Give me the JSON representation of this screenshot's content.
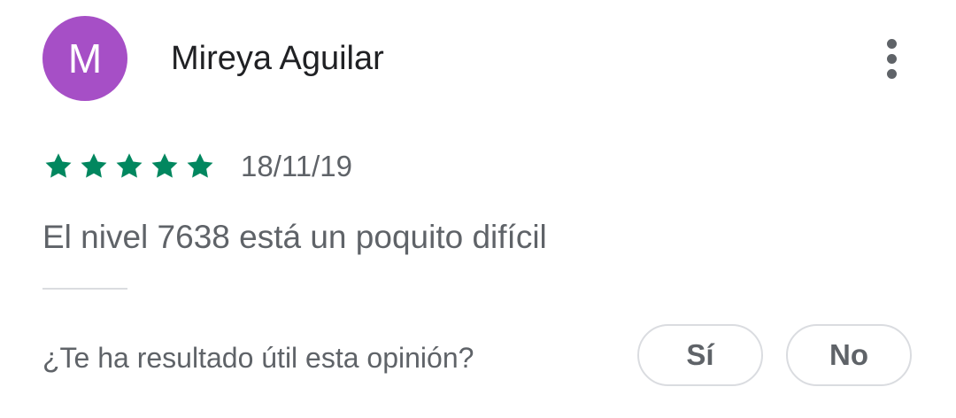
{
  "review": {
    "author_initial": "M",
    "author_name": "Mireya Aguilar",
    "avatar_color": "#a64fc6",
    "rating": 5,
    "rating_max": 5,
    "star_color": "#01875f",
    "date": "18/11/19",
    "text": "El nivel 7638 está un poquito difícil"
  },
  "menu": {
    "icon": "more-vert-icon"
  },
  "helpful": {
    "question": "¿Te ha resultado útil esta opinión?",
    "yes_label": "Sí",
    "no_label": "No"
  }
}
